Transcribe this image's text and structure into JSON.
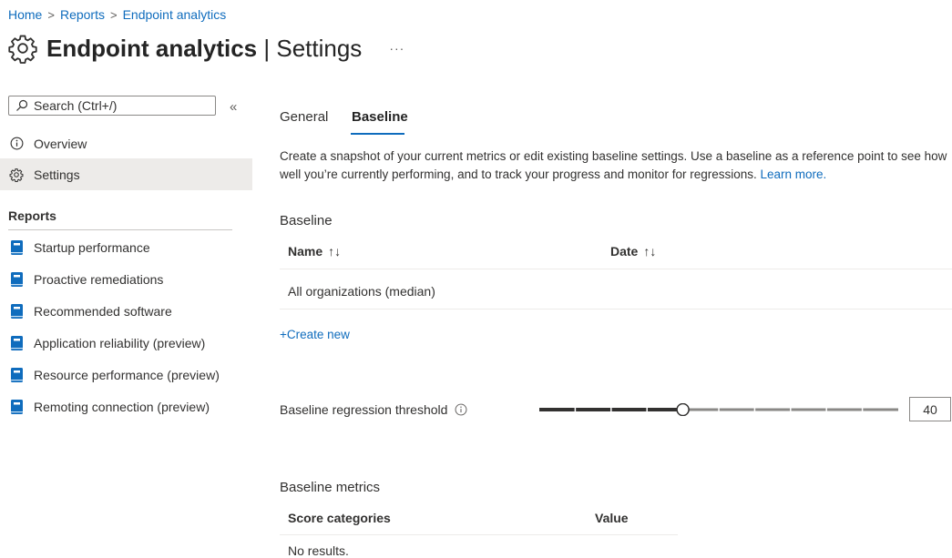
{
  "breadcrumb": {
    "items": [
      "Home",
      "Reports",
      "Endpoint analytics"
    ],
    "separator": ">"
  },
  "header": {
    "title_bold": "Endpoint analytics",
    "title_sep": " | ",
    "title_rest": "Settings",
    "more": "···"
  },
  "sidebar": {
    "search_placeholder": "Search (Ctrl+/)",
    "collapse": "«",
    "items": [
      {
        "label": "Overview",
        "icon": "info-icon"
      },
      {
        "label": "Settings",
        "icon": "gear-icon",
        "selected": true
      }
    ],
    "reports_heading": "Reports",
    "reports": [
      {
        "label": "Startup performance",
        "icon": "report-book-icon"
      },
      {
        "label": "Proactive remediations",
        "icon": "report-book-icon"
      },
      {
        "label": "Recommended software",
        "icon": "report-book-icon"
      },
      {
        "label": "Application reliability (preview)",
        "icon": "report-book-icon"
      },
      {
        "label": "Resource performance (preview)",
        "icon": "report-book-icon"
      },
      {
        "label": "Remoting connection (preview)",
        "icon": "report-book-icon"
      }
    ]
  },
  "tabs": [
    {
      "label": "General",
      "active": false
    },
    {
      "label": "Baseline",
      "active": true
    }
  ],
  "description": {
    "text": "Create a snapshot of your current metrics or edit existing baseline settings. Use a baseline as a reference point to see how well you’re currently performing, and to track your progress and monitor for regressions. ",
    "link": "Learn more."
  },
  "baseline": {
    "heading": "Baseline",
    "columns": [
      "Name",
      "Date"
    ],
    "sort_glyph": "↑↓",
    "rows": [
      {
        "name": "All organizations (median)",
        "date": ""
      }
    ],
    "create_new": "+Create new"
  },
  "threshold": {
    "label": "Baseline regression threshold",
    "value": "40",
    "slider_fraction": 0.4
  },
  "metrics": {
    "heading": "Baseline metrics",
    "columns": [
      "Score categories",
      "Value"
    ],
    "empty": "No results."
  },
  "colors": {
    "accent": "#0f6cbd",
    "selected_bg": "#edebe9",
    "report_icon": "#0f6cbd"
  }
}
